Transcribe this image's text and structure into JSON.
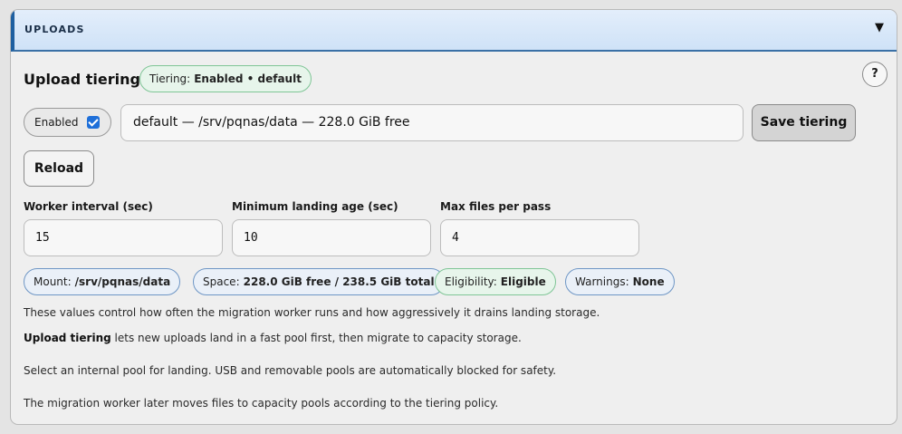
{
  "panel": {
    "title": "UPLOADS",
    "collapse_icon": "triangle-down-icon",
    "help_label": "?"
  },
  "tiering": {
    "section_title": "Upload tiering",
    "badge_label": "Tiering:",
    "badge_value": "Enabled • default",
    "enabled_label": "Enabled",
    "enabled_checked": true,
    "pool_selected": "default — /srv/pqnas/data — 228.0 GiB free",
    "save_label": "Save tiering",
    "reload_label": "Reload"
  },
  "fields": {
    "worker_interval_label": "Worker interval (sec)",
    "worker_interval_value": "15",
    "min_age_label": "Minimum landing age (sec)",
    "min_age_value": "10",
    "max_files_label": "Max files per pass",
    "max_files_value": "4"
  },
  "status": {
    "mount_label": "Mount:",
    "mount_value": "/srv/pqnas/data",
    "space_label": "Space:",
    "space_value": "228.0 GiB free / 238.5 GiB total",
    "eligibility_label": "Eligibility:",
    "eligibility_value": "Eligible",
    "warnings_label": "Warnings:",
    "warnings_value": "None"
  },
  "help": {
    "line1": "These values control how often the migration worker runs and how aggressively it drains landing storage.",
    "line2_bold": "Upload tiering",
    "line2_rest": " lets new uploads land in a fast pool first, then migrate to capacity storage.",
    "line3": "Select an internal pool for landing. USB and removable pools are automatically blocked for safety.",
    "line4": "The migration worker later moves files to capacity pools according to the tiering policy."
  },
  "colors": {
    "header_accent": "#1e5fa0",
    "pill_green_border": "#7fc596",
    "pill_blue_border": "#6e96c5",
    "checkbox": "#1e6fd9"
  }
}
